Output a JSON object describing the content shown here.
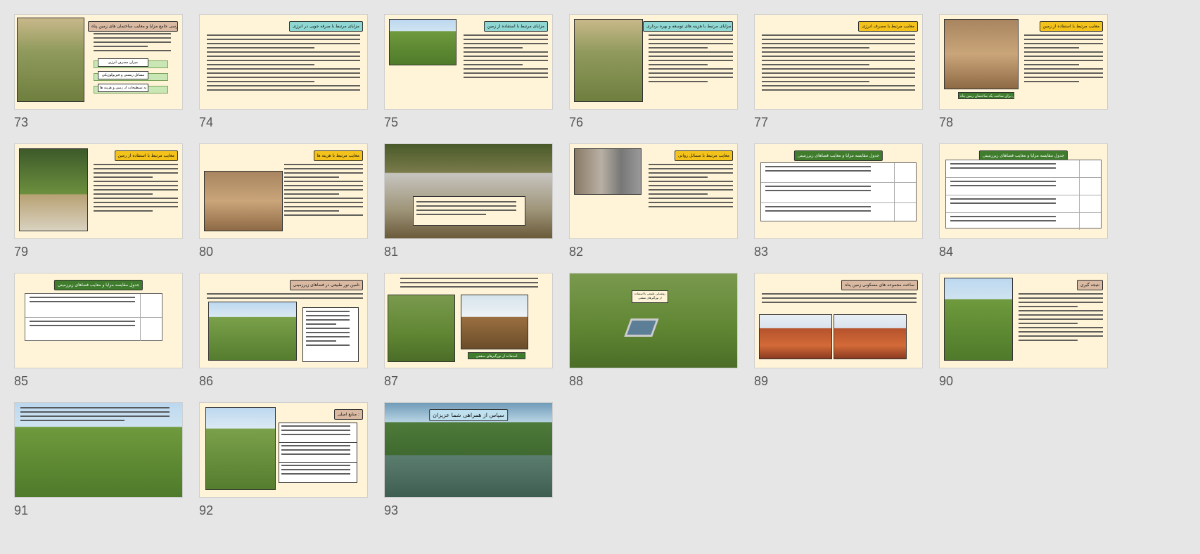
{
  "colors": {
    "background": "#e6e6e6",
    "slide_bg": "#fff4d8",
    "title_yellow": "#f3c21b",
    "title_teal": "#8fd7d2",
    "title_green": "#3f7d2d",
    "title_tan": "#d9b9a1",
    "title_blue": "#bfe0ee"
  },
  "slides": [
    {
      "num": "73",
      "title": "بررسی جامع مزایا و معایب ساختمان های زمین پناه",
      "title_color": "title_tan",
      "layout": "photo-left-boxes",
      "boxes": [
        "میزان مسرف انرژی",
        "مسائل زیستی و فیزیولوژیکی",
        "مسائل مربوط به تسطیحات از زمین و هزینه ها"
      ]
    },
    {
      "num": "74",
      "title": "مزایای مرتبط با صرفه جویی در انرژی",
      "title_color": "title_teal",
      "layout": "text-only"
    },
    {
      "num": "75",
      "title": "مزایای مرتبط با استفاده از زمین",
      "title_color": "title_teal",
      "layout": "photo-left-list"
    },
    {
      "num": "76",
      "title": "مزایای مرتبط با هزینه های توسعه و بهره برداری",
      "title_color": "title_teal",
      "layout": "photo-left-text"
    },
    {
      "num": "77",
      "title": "معایب مرتبط با مصرف انرژی",
      "title_color": "title_yellow",
      "layout": "text-only"
    },
    {
      "num": "78",
      "title": "معایب مرتبط با استفاده از زمین",
      "title_color": "title_yellow",
      "layout": "photo-left-text-caption",
      "caption": "تجهیزات سنگین برای ساخت یک ساختمان زمین پناه"
    },
    {
      "num": "79",
      "title": "معایب مرتبط با استفاده از زمین",
      "title_color": "title_yellow",
      "layout": "photo-left-text"
    },
    {
      "num": "80",
      "title": "معایب مرتبط با هزینه ها",
      "title_color": "title_yellow",
      "layout": "text-photo-bottom"
    },
    {
      "num": "81",
      "title": "",
      "title_color": "",
      "layout": "full-photo-caption"
    },
    {
      "num": "82",
      "title": "معایب مرتبط با مسائل روانی",
      "title_color": "title_yellow",
      "layout": "photo-left-list"
    },
    {
      "num": "83",
      "title": "جدول مقایسه مزایا و معایب فضاهای زیرزمینی",
      "title_color": "title_green",
      "layout": "table"
    },
    {
      "num": "84",
      "title": "جدول مقایسه مزایا و معایب فضاهای زیرزمینی",
      "title_color": "title_green",
      "layout": "table"
    },
    {
      "num": "85",
      "title": "جدول مقایسه مزایا و معایب فضاهای زیرزمینی",
      "title_color": "title_green",
      "layout": "table"
    },
    {
      "num": "86",
      "title": "تامین نور طبیعی در فضاهای زیرزمینی",
      "title_color": "title_tan",
      "layout": "photo-left-textbox"
    },
    {
      "num": "87",
      "title": "",
      "title_color": "",
      "layout": "two-photos-caption",
      "caption": "استفاده از نورگیرهای سقفی"
    },
    {
      "num": "88",
      "title": "",
      "title_color": "",
      "layout": "full-photo-caption",
      "caption": "روشنایی طبیعی با استفاده از نورگیرهای سقفی"
    },
    {
      "num": "89",
      "title": "ساخت مجموعه های مسکونی زمین پناه",
      "title_color": "title_tan",
      "layout": "two-photos-bottom"
    },
    {
      "num": "90",
      "title": "نتیجه گیری",
      "title_color": "title_tan",
      "layout": "photo-left-text"
    },
    {
      "num": "91",
      "title": "",
      "title_color": "",
      "layout": "full-photo-text"
    },
    {
      "num": "92",
      "title": "منابع اصلی :",
      "title_color": "title_tan",
      "layout": "photo-left-refs"
    },
    {
      "num": "93",
      "title": "سپاس از همراهی شما عزیزان",
      "title_color": "title_blue",
      "layout": "full-photo-title"
    }
  ]
}
